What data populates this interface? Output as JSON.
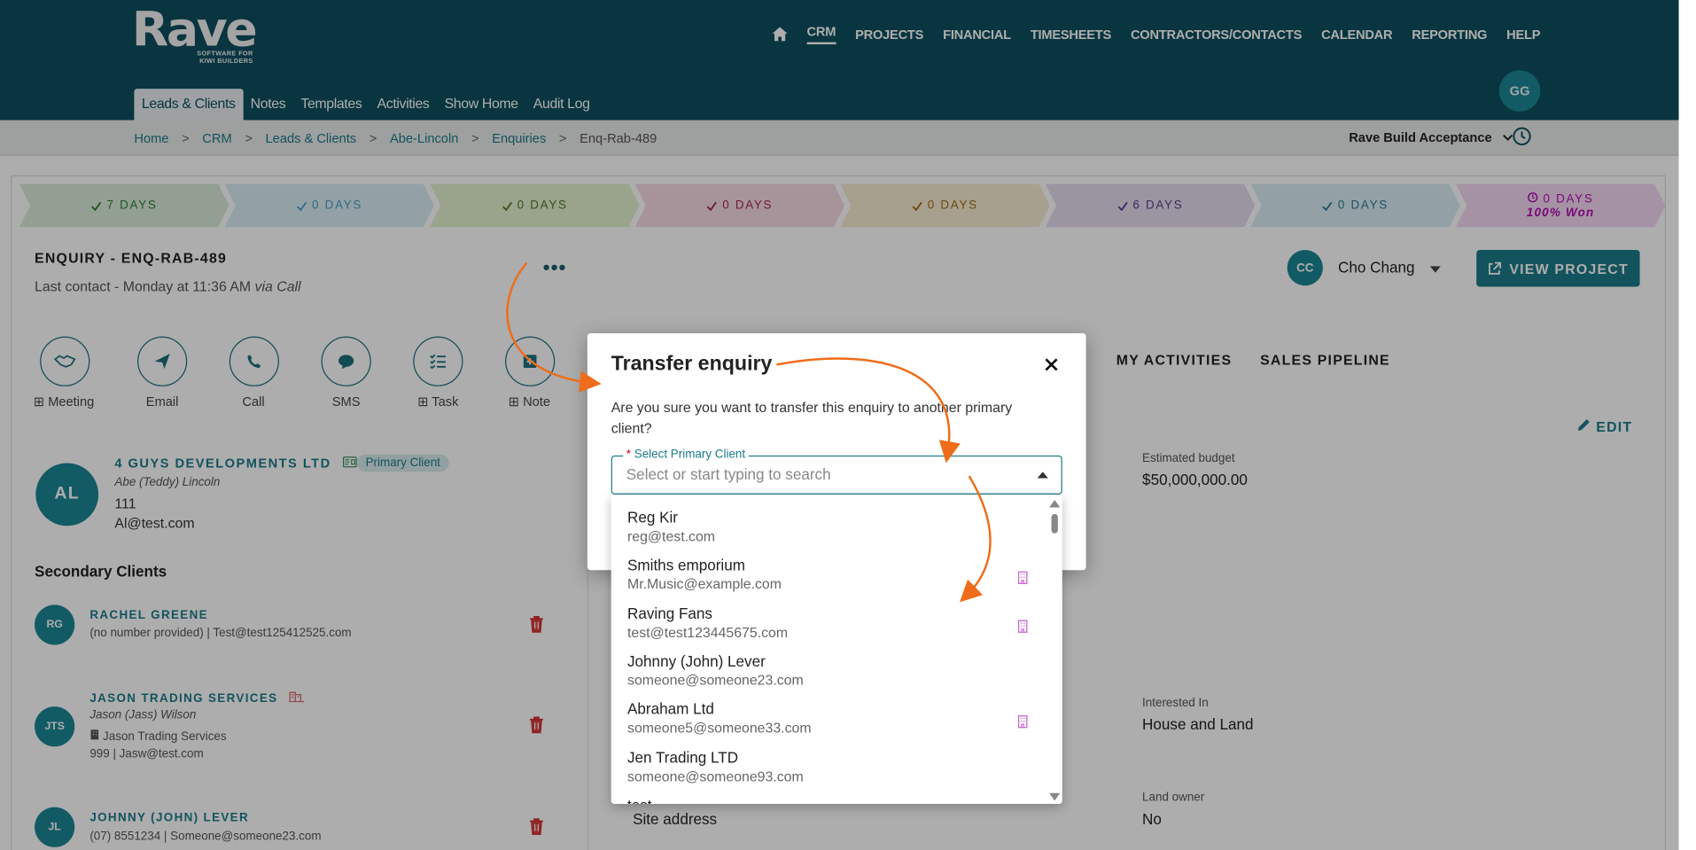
{
  "app": {
    "logo_word": "Rave",
    "logo_tag_1": "SOFTWARE FOR",
    "logo_tag_2": "KIWI BUILDERS"
  },
  "main_nav": [
    "CRM",
    "PROJECTS",
    "FINANCIAL",
    "TIMESHEETS",
    "CONTRACTORS/CONTACTS",
    "CALENDAR",
    "REPORTING",
    "HELP"
  ],
  "sub_nav": [
    "Leads & Clients",
    "Notes",
    "Templates",
    "Activities",
    "Show Home",
    "Audit Log"
  ],
  "user_initials": "GG",
  "breadcrumbs": [
    "Home",
    "CRM",
    "Leads & Clients",
    "Abe-Lincoln",
    "Enquiries",
    "Enq-Rab-489"
  ],
  "workflow_name": "Rave Build Acceptance",
  "stages": [
    {
      "label": "7 DAYS",
      "bg": "#d8ead8",
      "fg": "#2e7d32"
    },
    {
      "label": "0 DAYS",
      "bg": "#d9edf6",
      "fg": "#4b9bbf"
    },
    {
      "label": "0 DAYS",
      "bg": "#e3f0cf",
      "fg": "#4e7a1f"
    },
    {
      "label": "0 DAYS",
      "bg": "#f6dbe3",
      "fg": "#a0254f"
    },
    {
      "label": "0 DAYS",
      "bg": "#f8ecd3",
      "fg": "#9a6a14"
    },
    {
      "label": "6 DAYS",
      "bg": "#e5dcef",
      "fg": "#5b3b88"
    },
    {
      "label": "0 DAYS",
      "bg": "#d9edf6",
      "fg": "#2e7a8e"
    },
    {
      "label": "0 DAYS",
      "sub": "100% Won",
      "bg": "#f5d8f4",
      "fg": "#b10cb0"
    }
  ],
  "enquiry": {
    "title": "ENQUIRY - ENQ-RAB-489",
    "last_contact": "Last contact - Monday at 11:36 AM",
    "via": "via Call"
  },
  "actions": [
    "Meeting",
    "Email",
    "Call",
    "SMS",
    "Task",
    "Note"
  ],
  "owner": {
    "initials": "CC",
    "name": "Cho Chang"
  },
  "view_project_label": "VIEW PROJECT",
  "primary_client": {
    "initials": "AL",
    "name": "4 GUYS DEVELOPMENTS LTD",
    "badge": "Primary Client",
    "contact": "Abe (Teddy) Lincoln",
    "phone": "111",
    "email": "Al@test.com"
  },
  "secondary_title": "Secondary Clients",
  "secondary_clients": [
    {
      "initials": "RG",
      "name": "RACHEL GREENE",
      "line1": "(no number provided)  |  Test@test125412525.com"
    },
    {
      "initials": "JTS",
      "name": "JASON TRADING SERVICES",
      "contact": "Jason (Jass) Wilson",
      "company": "Jason Trading Services",
      "line1": "999  |  Jasw@test.com"
    },
    {
      "initials": "JL",
      "name": "JOHNNY (JOHN) LEVER",
      "line1": "(07) 8551234  |  Someone@someone23.com"
    }
  ],
  "right_tabs": [
    "MY ACTIVITIES",
    "SALES PIPELINE"
  ],
  "edit_label": "EDIT",
  "fields": {
    "budget_label": "Estimated budget",
    "budget_value": "$50,000,000.00",
    "interested_label": "Interested In",
    "interested_value": "House and Land",
    "landowner_label": "Land owner",
    "landowner_value": "No",
    "site_address": "Site address"
  },
  "modal": {
    "title": "Transfer enquiry",
    "text": "Are you sure you want to transfer this enquiry to another primary client?",
    "select_label": "Select Primary Client",
    "select_required": "*",
    "placeholder": "Select or start typing to search"
  },
  "dropdown_options": [
    {
      "name": "Reg Kir",
      "email": "reg@test.com",
      "company": false
    },
    {
      "name": "Smiths emporium",
      "email": "Mr.Music@example.com",
      "company": true
    },
    {
      "name": "Raving Fans",
      "email": "test@test123445675.com",
      "company": true
    },
    {
      "name": "Johnny (John) Lever",
      "email": "someone@someone23.com",
      "company": false
    },
    {
      "name": "Abraham Ltd",
      "email": "someone5@someone33.com",
      "company": true
    },
    {
      "name": "Jen Trading LTD",
      "email": "someone@someone93.com",
      "company": false
    },
    {
      "name": "test",
      "email": "",
      "company": false
    }
  ],
  "colors": {
    "brand": "#0c4f5f",
    "accent": "#1b7b8a",
    "annotation_arrow": "#ef6c1a",
    "company_icon": "#c86bd4",
    "delete": "#d32f2f"
  }
}
